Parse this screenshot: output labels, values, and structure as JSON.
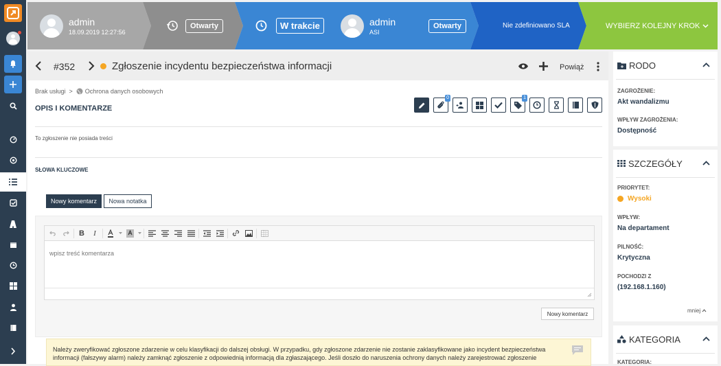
{
  "workflow": {
    "step1": {
      "user": "admin",
      "date": "18.09.2019 12:27:56"
    },
    "step2": {
      "status": "Otwarty"
    },
    "step3": {
      "status": "W trakcie",
      "user": "admin",
      "group": "ASI",
      "status2": "Otwarty"
    },
    "step4": {
      "label": "Nie zdefiniowano SLA"
    },
    "step5": {
      "label": "WYBIERZ KOLEJNY KROK"
    }
  },
  "ticket": {
    "id": "#352",
    "title": "Zgłoszenie incydentu bezpieczeństwa informacji",
    "status_color": "#f5a623",
    "link_label": "Powiąż",
    "breadcrumb_service": "Brak usługi",
    "breadcrumb_sep": ">",
    "breadcrumb_category": "Ochrona danych osobowych",
    "section_title": "OPIS I KOMENTARZE",
    "no_content": "To zgłoszenie nie posiada treści",
    "keywords_label": "SŁOWA KLUCZOWE"
  },
  "toolbar_badges": {
    "attachments": "0",
    "tags": "1"
  },
  "comment": {
    "tab_new_comment": "Nowy komentarz",
    "tab_new_note": "Nowa notatka",
    "placeholder": "wpisz treść komentarza",
    "submit_label": "Nowy komentarz"
  },
  "info_box": {
    "text": "Należy zweryfikować zgłoszone zdarzenie w celu klasyfikacji do dalszej obsługi. W przypadku, gdy zgłoszone zdarzenie nie zostanie zaklasyfikowane jako incydent bezpieczeństwa informacji (fałszywy alarm) należy zamknąć zgłoszenie z odpowiednią informacją dla zgłaszającego. Jeśli doszło do naruszenia ochrony danych należy zarejestrować zgłoszenie"
  },
  "right_panel": {
    "rodo": {
      "title": "RODO",
      "threat_label": "ZAGROŻENIE:",
      "threat_value": "Akt wandalizmu",
      "impact_label": "WPŁYW ZAGROŻENIA:",
      "impact_value": "Dostępność"
    },
    "details": {
      "title": "SZCZEGÓŁY",
      "priority_label": "PRIORYTET:",
      "priority_value": "Wysoki",
      "priority_color": "#f5a623",
      "influence_label": "WPŁYW:",
      "influence_value": "Na departament",
      "urgency_label": "PILNOŚĆ:",
      "urgency_value": "Krytyczna",
      "origin_label": "POCHODZI Z",
      "origin_value": "(192.168.1.160)",
      "less_label": "mniej"
    },
    "category": {
      "title": "KATEGORIA",
      "label": "KATEGORIA:"
    }
  },
  "colors": {
    "sidebar": "#2c3e50",
    "accent_orange": "#f08a24",
    "accent_blue": "#3a86d4",
    "step_grey": "#8e8e8e",
    "step_green": "#8dc63f"
  }
}
